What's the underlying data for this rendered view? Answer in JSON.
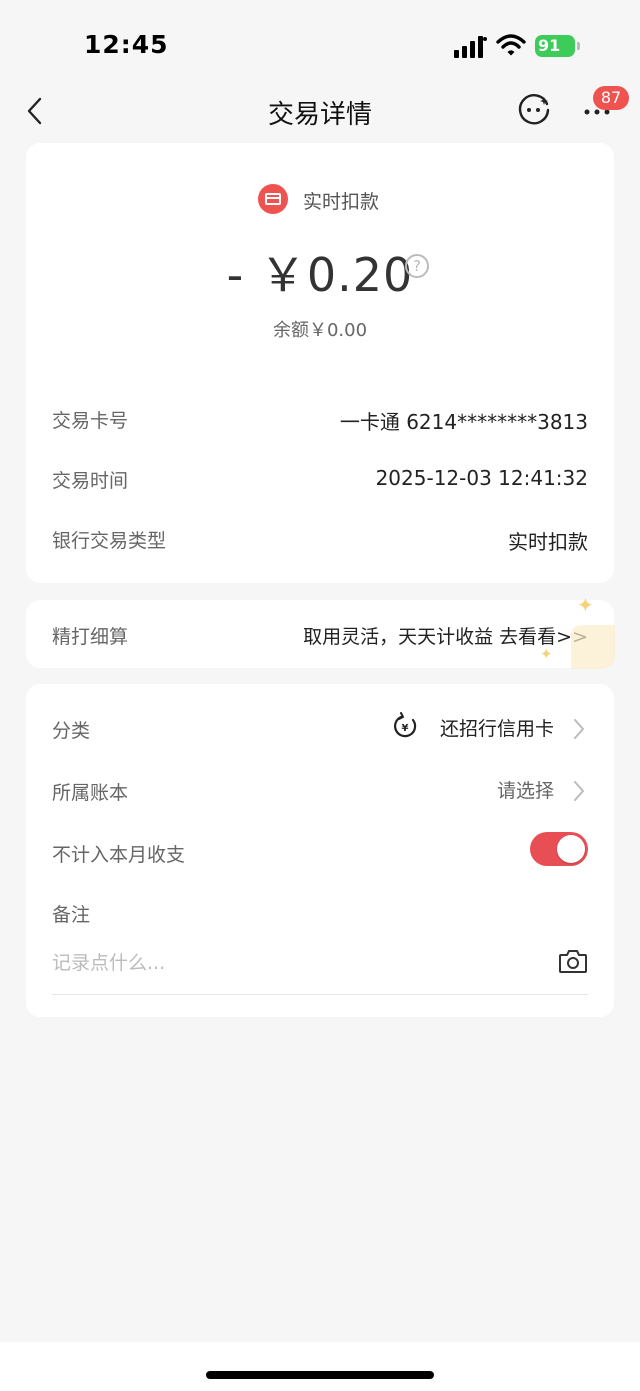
{
  "status_bar": {
    "time": "12:45",
    "battery": "91"
  },
  "nav": {
    "title": "交易详情",
    "badge": "87"
  },
  "transaction": {
    "type_label": "实时扣款",
    "amount": "- ￥0.20",
    "balance": "余额￥0.00",
    "details": [
      {
        "label": "交易卡号",
        "value": "一卡通 6214********3813"
      },
      {
        "label": "交易时间",
        "value": "2025-12-03 12:41:32"
      },
      {
        "label": "银行交易类型",
        "value": "实时扣款"
      }
    ]
  },
  "promo": {
    "label": "精打细算",
    "text": "取用灵活，天天计收益 去看看>>"
  },
  "settings": {
    "category_label": "分类",
    "category_value": "还招行信用卡",
    "book_label": "所属账本",
    "book_value": "请选择",
    "exclude_label": "不计入本月收支",
    "exclude_on": true,
    "note_label": "备注",
    "note_placeholder": "记录点什么..."
  },
  "colors": {
    "accent": "#ef5350",
    "battery": "#3dcc5a",
    "toggle": "#e84f55"
  }
}
